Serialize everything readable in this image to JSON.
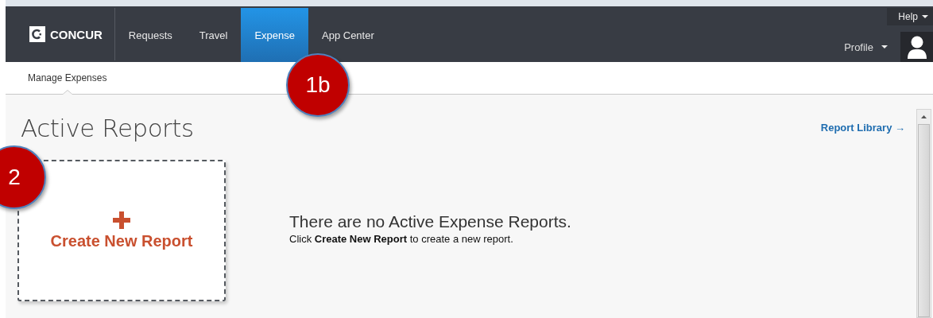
{
  "header": {
    "logo": "CONCUR",
    "tabs": [
      {
        "label": "Requests",
        "selected": false
      },
      {
        "label": "Travel",
        "selected": false
      },
      {
        "label": "Expense",
        "selected": true
      },
      {
        "label": "App Center",
        "selected": false
      }
    ],
    "help": "Help",
    "profile": "Profile"
  },
  "subnav": {
    "items": [
      {
        "label": "Manage Expenses",
        "selected": true
      }
    ]
  },
  "page": {
    "title": "Active Reports",
    "link": "Report Library →",
    "create_card": {
      "label": "Create New Report"
    },
    "empty_title": "There are no Active Expense Reports.",
    "empty_text": "Click **Create New Report** to create a new report."
  },
  "callouts": [
    {
      "label": "1b"
    },
    {
      "label": "2"
    }
  ]
}
